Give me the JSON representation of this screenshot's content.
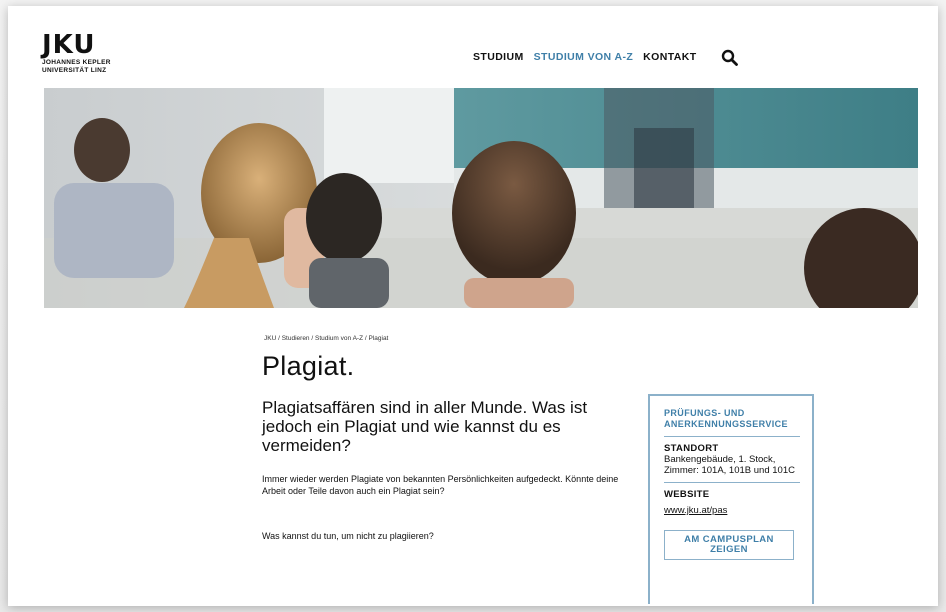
{
  "header": {
    "logo_mark": "JKU",
    "logo_line1": "JOHANNES KEPLER",
    "logo_line2": "UNIVERSITÄT LINZ",
    "nav": [
      {
        "label": "STUDIUM"
      },
      {
        "label": "STUDIUM VON A-Z",
        "active": true
      },
      {
        "label": "KONTAKT"
      }
    ]
  },
  "breadcrumb": [
    "JKU",
    "Studieren",
    "Studium von A-Z",
    "Plagiat"
  ],
  "breadcrumb_separator": "/",
  "main": {
    "title": "Plagiat.",
    "lead": "Plagiatsaffären sind in aller Munde. Was ist jedoch ein Plagiat und wie kannst du es vermeiden?",
    "paragraph1": "Immer wieder werden Plagiate von bekannten Persönlichkeiten aufgedeckt. Könnte deine Arbeit oder Teile davon auch ein Plagiat sein?",
    "paragraph2": "Was kannst du tun, um nicht zu plagiieren?"
  },
  "sidebox": {
    "title": "PRÜFUNGS- UND ANERKENNUNGSSERVICE",
    "standort_label": "STANDORT",
    "standort_text": "Bankengebäude, 1. Stock, Zimmer: 101A, 101B und 101C",
    "website_label": "WEBSITE",
    "website_link": "www.jku.at/pas",
    "button_label": "AM CAMPUSPLAN ZEIGEN"
  },
  "icons": {
    "search": "search-icon"
  },
  "colors": {
    "accent": "#3f7fa8",
    "box_border": "#8cb1ca"
  }
}
